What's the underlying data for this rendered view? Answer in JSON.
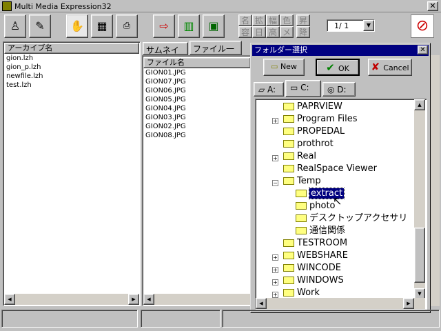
{
  "window": {
    "title": "Multi Media Expression32",
    "close_label": "✕"
  },
  "toolbar": {
    "kanji_row1": [
      "名",
      "拡",
      "幅",
      "色",
      "昇"
    ],
    "kanji_row2": [
      "容",
      "日",
      "高",
      "メ",
      "降"
    ],
    "page_selector": "1/ 1"
  },
  "archive_panel": {
    "header": "アーカイブ名",
    "items": [
      "gion.lzh",
      "gion_p.lzh",
      "newfile.lzh",
      "test.lzh"
    ]
  },
  "file_panel": {
    "tabs": [
      "サムネイル",
      "ファイル一覧"
    ],
    "header": "ファイル名",
    "items": [
      "GION01.JPG",
      "GION07.JPG",
      "GION06.JPG",
      "GION05.JPG",
      "GION04.JPG",
      "GION03.JPG",
      "GION02.JPG",
      "GION08.JPG"
    ]
  },
  "dialog": {
    "title": "フォルダー選択",
    "close_label": "✕",
    "buttons": {
      "new": "New",
      "ok": "OK",
      "cancel": "Cancel"
    },
    "drives": [
      "A:",
      "C:",
      "D:"
    ],
    "tree": [
      {
        "label": "PAPRVIEW",
        "expandable": false
      },
      {
        "label": "Program Files",
        "expandable": true
      },
      {
        "label": "PROPEDAL",
        "expandable": false
      },
      {
        "label": "prothrot",
        "expandable": false
      },
      {
        "label": "Real",
        "expandable": true
      },
      {
        "label": "RealSpace Viewer",
        "expandable": false
      },
      {
        "label": "Temp",
        "expandable": true
      },
      {
        "label": "extract",
        "expandable": false
      },
      {
        "label": "photo",
        "expandable": false
      },
      {
        "label": "デスクトップアクセサリ",
        "expandable": false
      },
      {
        "label": "通信関係",
        "expandable": false
      },
      {
        "label": "TESTROOM",
        "expandable": false
      },
      {
        "label": "WEBSHARE",
        "expandable": true
      },
      {
        "label": "WINCODE",
        "expandable": true
      },
      {
        "label": "WINDOWS",
        "expandable": true
      },
      {
        "label": "Work",
        "expandable": true
      }
    ],
    "selected": "extract"
  },
  "colors": {
    "selection": "#000080",
    "face": "#c0c0c0"
  }
}
